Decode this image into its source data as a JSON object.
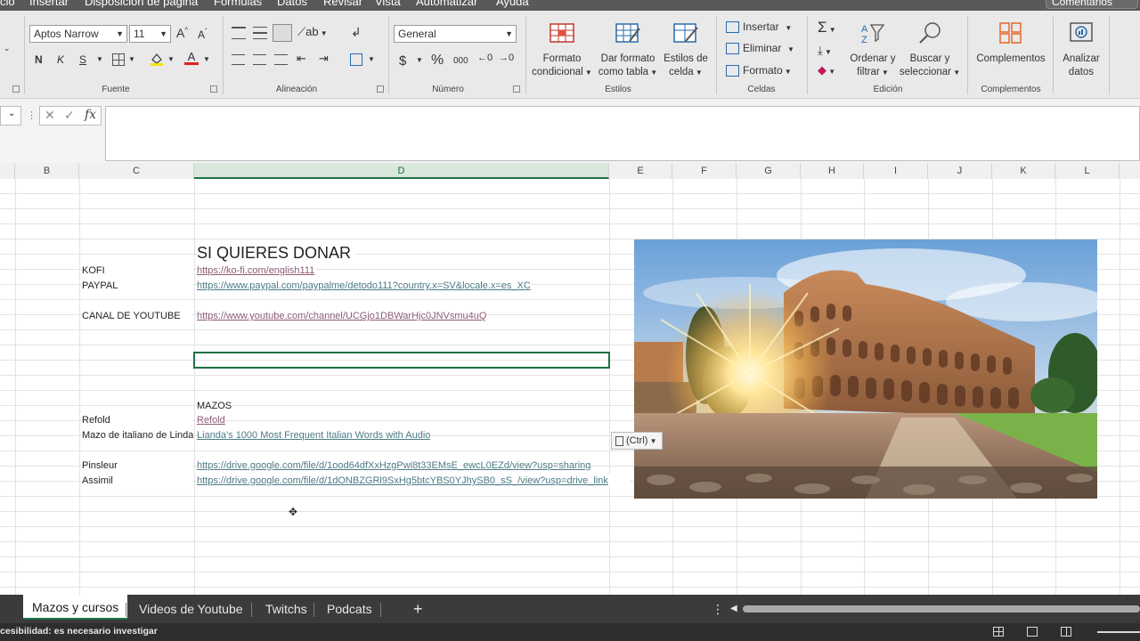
{
  "menu": {
    "items": [
      "cio",
      "Insertar",
      "Disposición de página",
      "Fórmulas",
      "Datos",
      "Revisar",
      "Vista",
      "Automatizar",
      "Ayuda"
    ],
    "comments": "Comentarios"
  },
  "ribbon": {
    "font": {
      "name": "Aptos Narrow",
      "size": "11",
      "bold": "N",
      "italic": "K",
      "underline": "S",
      "label": "Fuente"
    },
    "alignment": {
      "label": "Alineación"
    },
    "number": {
      "format": "General",
      "currency": "$",
      "percent": "%",
      "thousands": "000",
      "label": "Número"
    },
    "styles": {
      "conditional": [
        "Formato",
        "condicional"
      ],
      "as_table": [
        "Dar formato",
        "como tabla"
      ],
      "cell_styles": [
        "Estilos de",
        "celda"
      ],
      "label": "Estilos"
    },
    "cells": {
      "insert": "Insertar",
      "delete": "Eliminar",
      "format": "Formato",
      "label": "Celdas"
    },
    "editing": {
      "sort": [
        "Ordenar y",
        "filtrar"
      ],
      "find": [
        "Buscar y",
        "seleccionar"
      ],
      "label": "Edición"
    },
    "addins": {
      "button": "Complementos",
      "label": "Complementos"
    },
    "analyze": {
      "button": [
        "Analizar",
        "datos"
      ]
    }
  },
  "formula_bar": {
    "fx": "fx",
    "value": ""
  },
  "columns": [
    "B",
    "C",
    "D",
    "E",
    "F",
    "G",
    "H",
    "I",
    "J",
    "K",
    "L"
  ],
  "active_column": "D",
  "sheet": {
    "title": "SI QUIERES DONAR",
    "donations": [
      {
        "label": "KOFI",
        "url": "https://ko-fi.com/english111",
        "visited": true
      },
      {
        "label": "PAYPAL",
        "url": "https://www.paypal.com/paypalme/detodo111?country.x=SV&locale.x=es_XC",
        "visited": false
      },
      {
        "label": "CANAL DE YOUTUBE",
        "url": "https://www.youtube.com/channel/UCGjo1DBWarHjc0JNVsmu4uQ",
        "visited": true
      }
    ],
    "decks_header": "MAZOS",
    "decks": [
      {
        "label": "Refold",
        "url": "Refold",
        "visited": true
      },
      {
        "label": "Mazo de italiano de Linda",
        "url": "Lianda's 1000 Most Frequent Italian Words with Audio",
        "visited": false
      },
      {
        "label": "Pinsleur",
        "url": "https://drive.google.com/file/d/1ood64dfXxHzgPwi8t33EMsE_ewcL0EZd/view?usp=sharing",
        "visited": false
      },
      {
        "label": "Assimil",
        "url": "https://drive.google.com/file/d/1dONBZGRl9SxHg5btcYBS0YJhySB0_sS_/view?usp=drive_link",
        "visited": false
      }
    ],
    "paste_options": "(Ctrl)"
  },
  "tabs": [
    "Mazos y cursos",
    "Videos de Youtube",
    "Twitchs",
    "Podcats"
  ],
  "active_tab": "Mazos y cursos",
  "add_sheet": "+",
  "status": "cesibilidad: es necesario investigar",
  "colors": {
    "accent": "#1e7145",
    "link": "#4c7a85",
    "visited_link": "#8c5a75"
  }
}
